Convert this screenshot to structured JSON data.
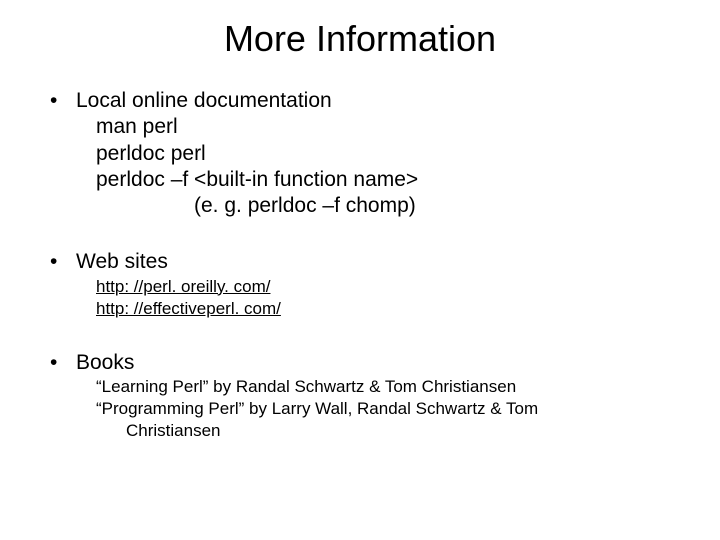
{
  "title": "More Information",
  "bullets": {
    "local": {
      "heading": "Local online documentation",
      "line1": "man perl",
      "line2": "perldoc perl",
      "line3": "perldoc –f  <built-in function name>",
      "line4": "(e. g. perldoc –f chomp)"
    },
    "web": {
      "heading": "Web sites",
      "link1": "http: //perl. oreilly. com/",
      "link2": "http: //effectiveperl. com/"
    },
    "books": {
      "heading": "Books",
      "book1": "“Learning Perl” by Randal Schwartz & Tom Christiansen",
      "book2a": "“Programming Perl” by Larry Wall, Randal Schwartz & Tom",
      "book2b": "Christiansen"
    }
  }
}
